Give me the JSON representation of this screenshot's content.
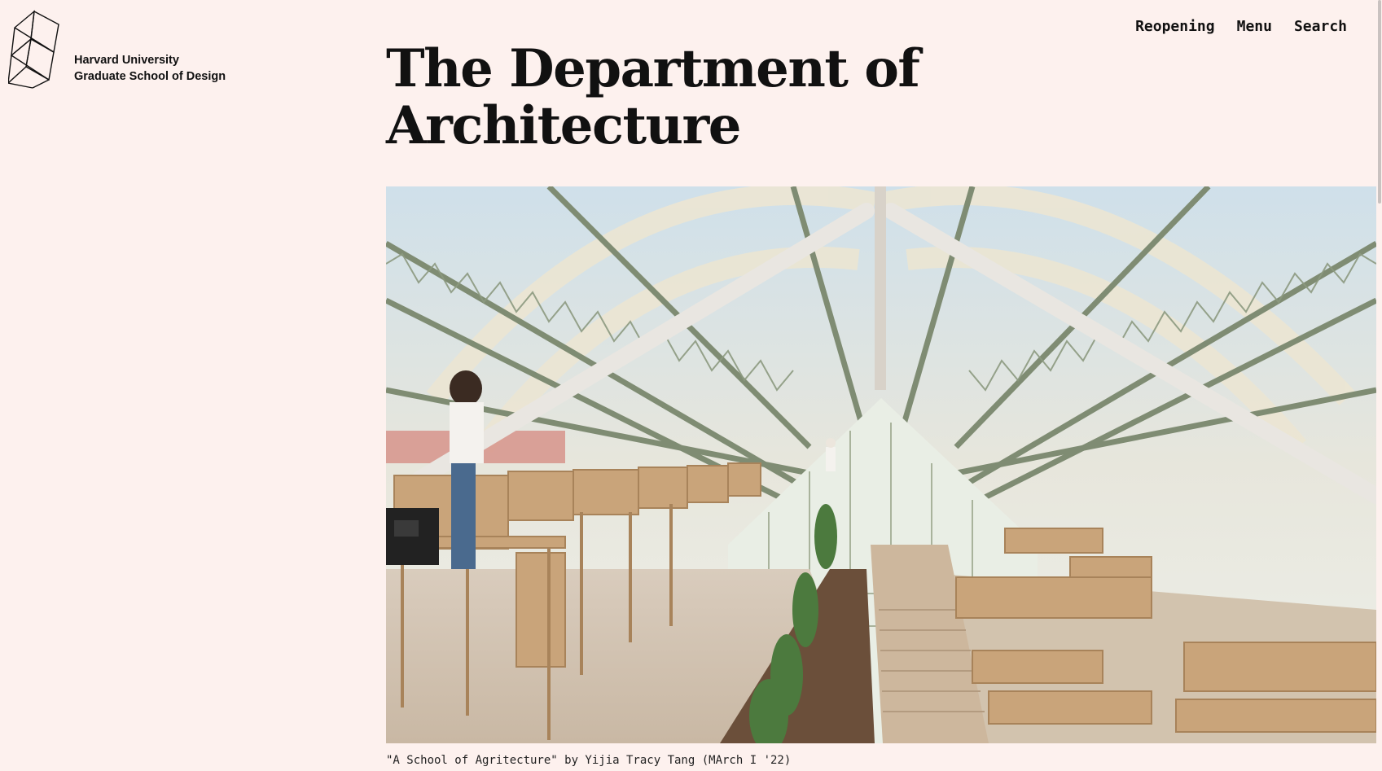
{
  "logo": {
    "icon": "gsd-logo-icon",
    "line1": "Harvard University",
    "line2": "Graduate School of Design"
  },
  "nav": {
    "reopening": "Reopening",
    "menu": "Menu",
    "search": "Search"
  },
  "page": {
    "title_line1": "The Department of",
    "title_line2": "Architecture"
  },
  "hero": {
    "caption": "\"A School of Agritecture\" by Yijia Tracy Tang (MArch I '22)"
  },
  "colors": {
    "background": "#fdf1ee",
    "text": "#111111"
  }
}
